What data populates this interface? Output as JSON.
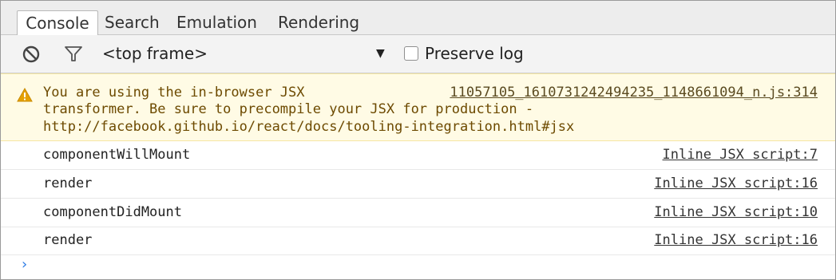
{
  "tabs": [
    {
      "label": "Console"
    },
    {
      "label": "Search"
    },
    {
      "label": "Emulation"
    },
    {
      "label": "Rendering"
    }
  ],
  "toolbar": {
    "frame_select_value": "<top frame>",
    "preserve_log_label": "Preserve log",
    "preserve_log_checked": false,
    "clear_icon": "no-entry-icon",
    "filter_icon": "funnel-icon"
  },
  "messages": {
    "warning": {
      "icon": "warning-triangle-icon",
      "lines": [
        "You are using the in-browser JSX",
        "transformer. Be sure to precompile your JSX for production -",
        "http://facebook.github.io/react/docs/tooling-integration.html#jsx"
      ],
      "source": "11057105_1610731242494235_1148661094_n.js:314"
    },
    "logs": [
      {
        "text": "componentWillMount",
        "source": "Inline JSX script:7"
      },
      {
        "text": "render",
        "source": "Inline JSX script:16"
      },
      {
        "text": "componentDidMount",
        "source": "Inline JSX script:10"
      },
      {
        "text": "render",
        "source": "Inline JSX script:16"
      }
    ]
  },
  "prompt_symbol": "›",
  "colors": {
    "warning_bg": "#fffbe5",
    "warning_icon": "#e5a100",
    "prompt": "#2e7ce5"
  }
}
